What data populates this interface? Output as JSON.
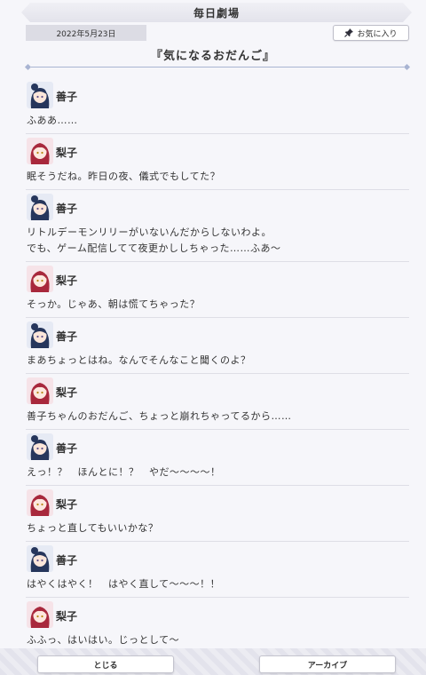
{
  "header": {
    "title": "毎日劇場"
  },
  "date": "2022年5月23日",
  "favorite_label": "お気に入り",
  "story_title": "『気になるおだんご』",
  "dialogue": [
    {
      "speaker": "善子",
      "text": "ふああ……"
    },
    {
      "speaker": "梨子",
      "text": "眠そうだね。昨日の夜、儀式でもしてた？"
    },
    {
      "speaker": "善子",
      "text": "リトルデーモンリリーがいないんだからしないわよ。",
      "text2": "でも、ゲーム配信してて夜更かししちゃった……ふあ〜"
    },
    {
      "speaker": "梨子",
      "text": "そっか。じゃあ、朝は慌てちゃった？"
    },
    {
      "speaker": "善子",
      "text": "まあちょっとはね。なんでそんなこと聞くのよ？"
    },
    {
      "speaker": "梨子",
      "text": "善子ちゃんのおだんご、ちょっと崩れちゃってるから……"
    },
    {
      "speaker": "善子",
      "text": "えっ！？　ほんとに！？　やだ〜〜〜〜！"
    },
    {
      "speaker": "梨子",
      "text": "ちょっと直してもいいかな？"
    },
    {
      "speaker": "善子",
      "text": "はやくはやく！　はやく直して〜〜〜！！"
    },
    {
      "speaker": "梨子",
      "text": "ふふっ、はいはい。じっとして〜"
    }
  ],
  "footer": {
    "close_label": "とじる",
    "archive_label": "アーカイブ"
  }
}
